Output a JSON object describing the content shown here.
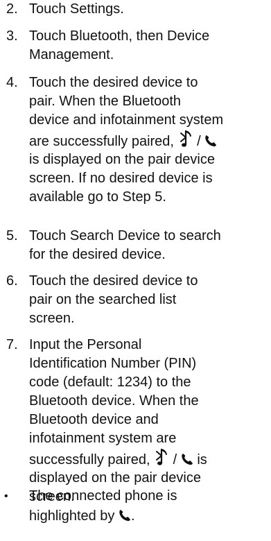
{
  "steps": [
    {
      "number": "2.",
      "parts": [
        "Touch Settings."
      ]
    },
    {
      "number": "3.",
      "parts": [
        "Touch Bluetooth, then Device",
        "Management."
      ]
    },
    {
      "number": "4.",
      "parts": [
        "Touch the desired device to",
        "pair. When the Bluetooth",
        "device and infotainment system",
        "are successfully paired,",
        "/",
        "is displayed on the pair device",
        "screen. If no desired device is",
        "available go to Step 5."
      ]
    },
    {
      "number": "5.",
      "parts": [
        "Touch Search Device to search",
        "for the desired device."
      ]
    },
    {
      "number": "6.",
      "parts": [
        "Touch the desired device to",
        "pair on the searched list",
        "screen."
      ]
    },
    {
      "number": "7.",
      "parts": [
        "Input the Personal",
        "Identification Number (PIN)",
        "code (default: 1234) to the",
        "Bluetooth device. When the",
        "Bluetooth device and",
        "infotainment system are",
        "successfully paired,",
        "/",
        "is",
        "displayed on the pair device",
        "screen."
      ]
    }
  ],
  "bullet": {
    "symbol": "•",
    "lines": [
      "The connected phone is",
      "highlighted by",
      "."
    ]
  },
  "icons": {
    "bluetooth_music": "bluetooth-music-icon",
    "phone": "phone-icon"
  }
}
